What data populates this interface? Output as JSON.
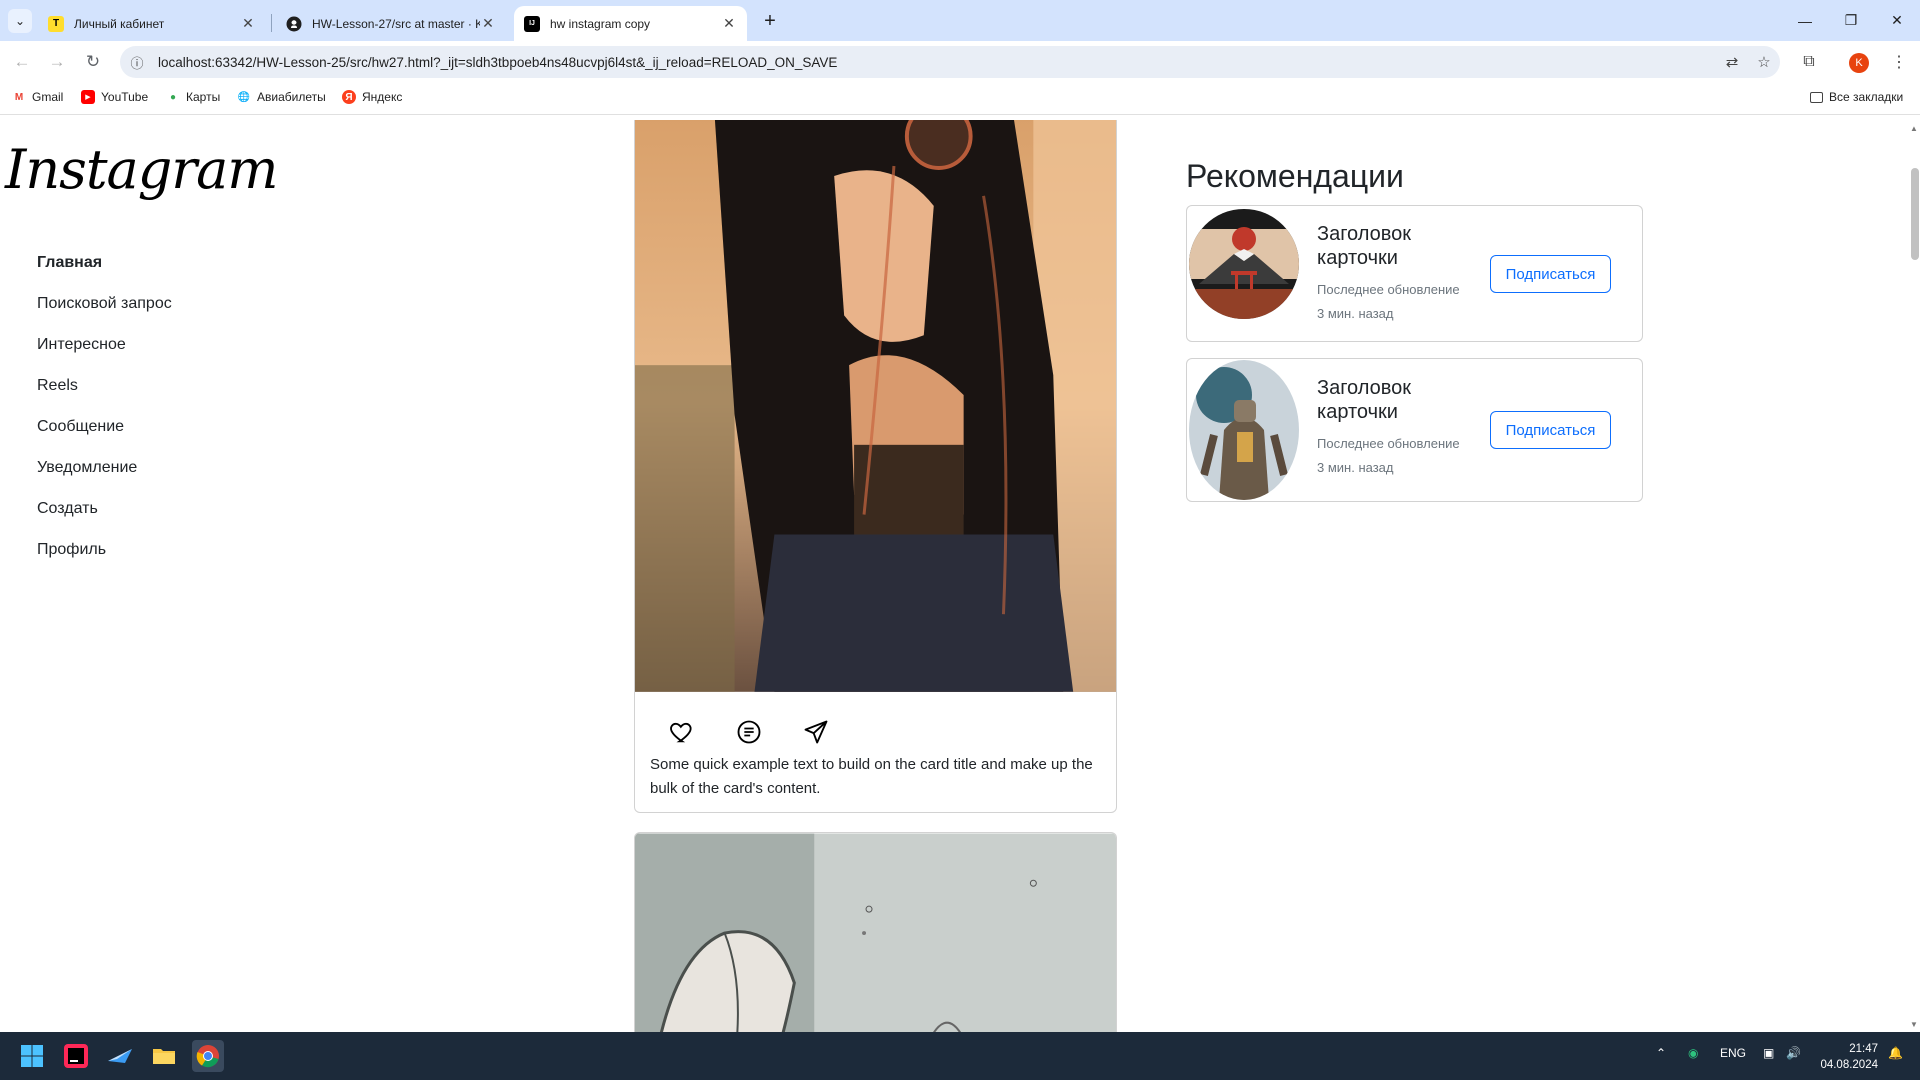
{
  "browser": {
    "tabs": [
      {
        "title": "Личный кабинет",
        "favicon": "T"
      },
      {
        "title": "HW-Lesson-27/src at master · K",
        "favicon": "github-icon"
      },
      {
        "title": "hw instagram copy",
        "favicon": "IJ"
      }
    ],
    "new_tab": "+",
    "url": "localhost:63342/HW-Lesson-25/src/hw27.html?_ijt=sldh3tbpoeb4ns48ucvpj6l4st&_ij_reload=RELOAD_ON_SAVE",
    "profile_initial": "K",
    "bookmarks": [
      "Gmail",
      "YouTube",
      "Карты",
      "Авиабилеты",
      "Яндекс"
    ],
    "all_bookmarks": "Все закладки"
  },
  "page": {
    "logo": "Instagram",
    "nav": [
      "Главная",
      "Поисковой запрос",
      "Интересное",
      "Reels",
      "Сообщение",
      "Уведомление",
      "Создать",
      "Профиль"
    ],
    "post": {
      "text": "Some quick example text to build on the card title and make up the bulk of the card's content."
    },
    "recommendations": {
      "title": "Рекомендации",
      "cards": [
        {
          "title": "Заголовок карточки",
          "updated": "Последнее обновление",
          "time": "3 мин. назад",
          "button": "Подписаться"
        },
        {
          "title": "Заголовок карточки",
          "updated": "Последнее обновление",
          "time": "3 мин. назад",
          "button": "Подписаться"
        }
      ]
    }
  },
  "taskbar": {
    "lang": "ENG",
    "time": "21:47",
    "date": "04.08.2024"
  },
  "colors": {
    "tabstrip": "#d3e3fd",
    "accent": "#0d6efd",
    "taskbar": "#1c2a3a"
  }
}
